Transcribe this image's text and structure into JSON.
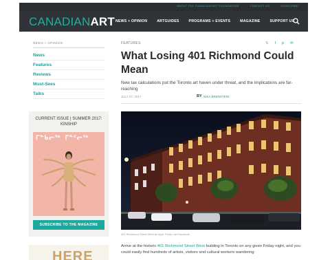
{
  "top_links": [
    "ABOUT THE CANADIAN ART FOUNDATION",
    "CONTACT US",
    "SUBSCRIBE"
  ],
  "logo": {
    "part1": "CANADIAN",
    "part2": "ART"
  },
  "nav": [
    "NEWS + OPINION",
    "ARTGUIDES",
    "PROGRAMS + EVENTS",
    "MAGAZINE",
    "SUPPORT US"
  ],
  "sidebar": {
    "heading": "NEWS + OPINION",
    "items": [
      "News",
      "Features",
      "Reviews",
      "Must-Sees",
      "Talks"
    ]
  },
  "issue": {
    "line1": "CURRENT ISSUE | SUMMER 2017:",
    "line2": "KINSHIP",
    "cover_title": "ᒥᓐᑲᓕᖅ ᒥᓐᑦᓕᖅ",
    "subscribe": "SUBSCRIBE TO THE MAGAZINE"
  },
  "ad": {
    "text": "HERE"
  },
  "article": {
    "section": "FEATURES",
    "title": "What Losing 401 Richmond Could Mean",
    "dek": "New tax calculations put the Toronto art haven under threat, and the implications are far-reaching",
    "date": "JULY 27, 2017",
    "by": "BY",
    "author": "NIKA BRENSTEIN",
    "caption": "401 Richmond Street West at night. Photo via Facebook.",
    "body_before": "Arrive at the historic ",
    "body_link": "401 Richmond Street West",
    "body_after": " building in Toronto on any given Friday night, and you could easily find hundreds of artists, visitors and cultural workers wandering"
  },
  "share_icons": [
    "twitter-icon",
    "facebook-icon",
    "pinterest-icon",
    "email-icon"
  ],
  "colors": {
    "teal": "#1fb0a5",
    "nav_bg": "#303338",
    "cover_bg": "#f2b5a8"
  }
}
